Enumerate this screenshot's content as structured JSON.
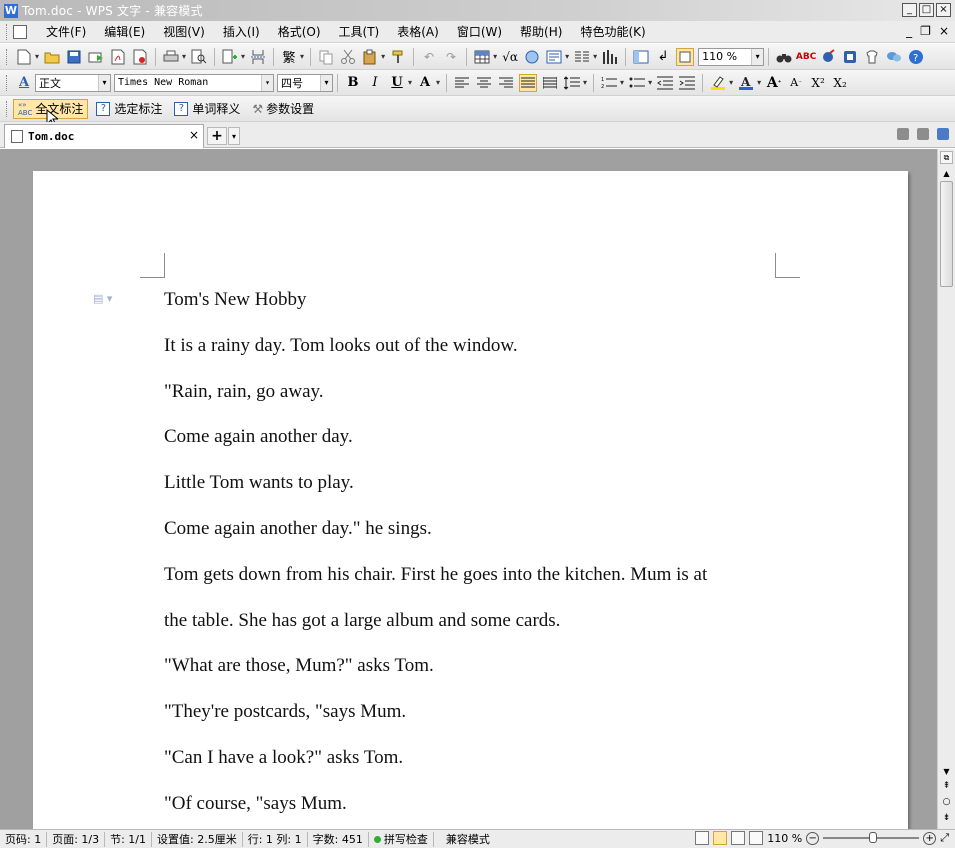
{
  "window": {
    "title": "Tom.doc - WPS 文字 - 兼容模式",
    "app_letter": "W",
    "min": "_",
    "max": "□",
    "close": "×"
  },
  "menu": {
    "items": [
      "文件(F)",
      "编辑(E)",
      "视图(V)",
      "插入(I)",
      "格式(O)",
      "工具(T)",
      "表格(A)",
      "窗口(W)",
      "帮助(H)",
      "特色功能(K)"
    ],
    "right_min": "_",
    "right_restore": "❐",
    "right_close": "×"
  },
  "toolbar_std": {
    "zoom_value": "110 %"
  },
  "toolbar_fmt": {
    "style_value": "正文",
    "font_value": "Times New Roman",
    "size_value": "四号",
    "bold": "B",
    "italic": "I",
    "underline": "U",
    "superscript": "X²",
    "subscript": "X₂"
  },
  "tag_toolbar": {
    "full_tag": "全文标注",
    "selected_tag": "选定标注",
    "word_def": "单词释义",
    "settings": "参数设置"
  },
  "tabs": {
    "doc_tab_label": "Tom.doc",
    "close": "×",
    "new_tab": "+"
  },
  "document": {
    "lines": [
      "Tom's New Hobby",
      "It is a rainy day. Tom looks out of the window.",
      "\"Rain, rain, go away.",
      "Come again another day.",
      "Little Tom wants to play.",
      "Come again another day.\" he sings.",
      "Tom gets down from his chair. First he goes into the kitchen. Mum is at",
      "the table. She has got a large album and some cards.",
      "\"What are those, Mum?\" asks Tom.",
      "\"They're postcards, \"says Mum.",
      "\"Can I have a look?\" asks Tom.",
      "\"Of course, \"says Mum."
    ]
  },
  "statusbar": {
    "page_code": "页码: 1",
    "page": "页面: 1/3",
    "section": "节: 1/1",
    "setting": "设置值: 2.5厘米",
    "row_col": "行: 1  列: 1",
    "word_count": "字数: 451",
    "spell_check": "拼写检查",
    "compat_mode": "兼容模式",
    "zoom": "110 %"
  }
}
